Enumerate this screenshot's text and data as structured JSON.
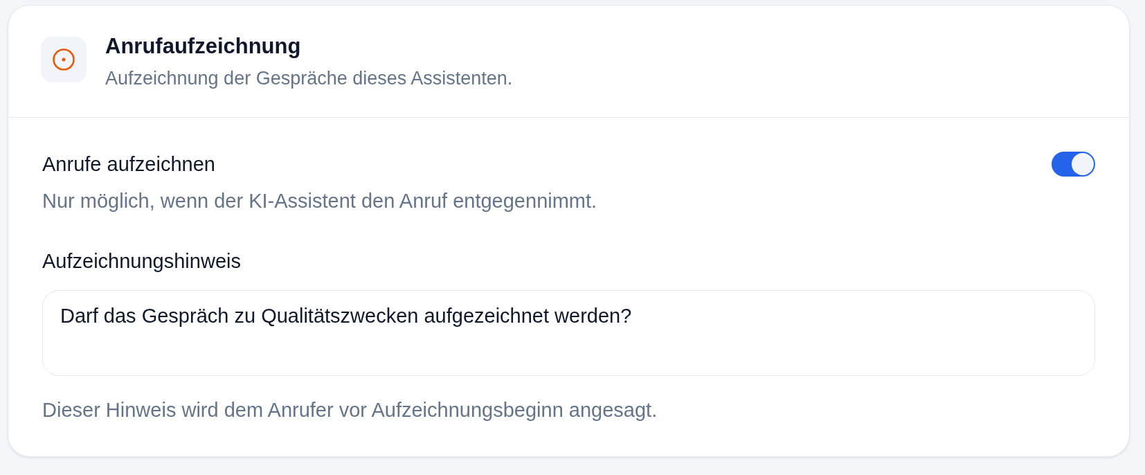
{
  "header": {
    "title": "Anrufaufzeichnung",
    "subtitle": "Aufzeichnung der Gespräche dieses Assistenten."
  },
  "settings": [
    {
      "kind": "toggle",
      "label": "Anrufe aufzeichnen",
      "description": "Nur möglich, wenn der KI-Assistent den Anruf entgegennimmt.",
      "on": true
    },
    {
      "kind": "textarea",
      "label": "Aufzeichnungshinweis",
      "value": "Darf das Gespräch zu Qualitätszwecken aufgezeichnet werden?",
      "hint": "Dieser Hinweis wird dem Anrufer vor Aufzeichnungsbeginn angesagt."
    }
  ]
}
